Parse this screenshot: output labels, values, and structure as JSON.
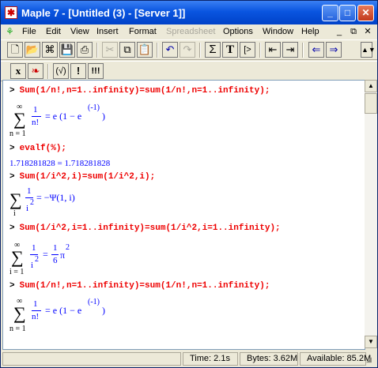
{
  "window": {
    "title": "Maple 7  - [Untitled (3) - [Server 1]]",
    "controls": {
      "minimize": "_",
      "maximize": "□",
      "close": "✕"
    }
  },
  "menubar": {
    "items": [
      "File",
      "Edit",
      "View",
      "Insert",
      "Format",
      "Spreadsheet",
      "Options",
      "Window",
      "Help"
    ],
    "disabled": [
      "Spreadsheet"
    ],
    "mdi": {
      "minimize": "_",
      "restore": "⧉",
      "close": "✕"
    }
  },
  "toolbar2": {
    "labels": {
      "x": "x",
      "leaf": "❧",
      "func": "(√)",
      "bang": "!",
      "bang3": "!!!"
    }
  },
  "toolbar1": {
    "labels": {
      "sigma": "Σ",
      "text": "T",
      "prompt": "[>"
    }
  },
  "worksheet": {
    "prompt": ">",
    "blocks": [
      {
        "input": "Sum(1/n!,n=1..infinity)=sum(1/n!,n=1..infinity);"
      },
      {
        "input": "evalf(%);"
      },
      {
        "input": "Sum(1/i^2,i)=sum(1/i^2,i);"
      },
      {
        "input": "Sum(1/i^2,i=1..infinity)=sum(1/i^2,i=1..infinity);"
      },
      {
        "input": "Sum(1/n!,n=1..infinity)=sum(1/n!,n=1..infinity);"
      }
    ],
    "outputs": {
      "o1": {
        "sigma": "∑",
        "upper": "∞",
        "lower": "n = 1",
        "num": "1",
        "den": "n!",
        "rhs_pre": "= e (1 − e",
        "exp": "(-1)",
        "rhs_post": ")"
      },
      "o2": {
        "text": "1.718281828 = 1.718281828"
      },
      "o3": {
        "sigma": "∑",
        "lower": "i",
        "num": "1",
        "den": "i",
        "den_exp": "2",
        "rhs": "= −Ψ(1, i)"
      },
      "o4": {
        "sigma": "∑",
        "upper": "∞",
        "lower": "i = 1",
        "num": "1",
        "den": "i",
        "den_exp": "2",
        "rhs_eq": "=",
        "rhs_num": "1",
        "rhs_den": "6",
        "rhs_pi": "π",
        "rhs_exp": "2"
      },
      "o5": {
        "sigma": "∑",
        "upper": "∞",
        "lower": "n = 1",
        "num": "1",
        "den": "n!",
        "rhs_pre": "= e (1 − e",
        "exp": "(-1)",
        "rhs_post": ")"
      }
    }
  },
  "statusbar": {
    "time": "Time:  2.1s",
    "bytes": "Bytes: 3.62M",
    "available": "Available: 85.2M"
  }
}
